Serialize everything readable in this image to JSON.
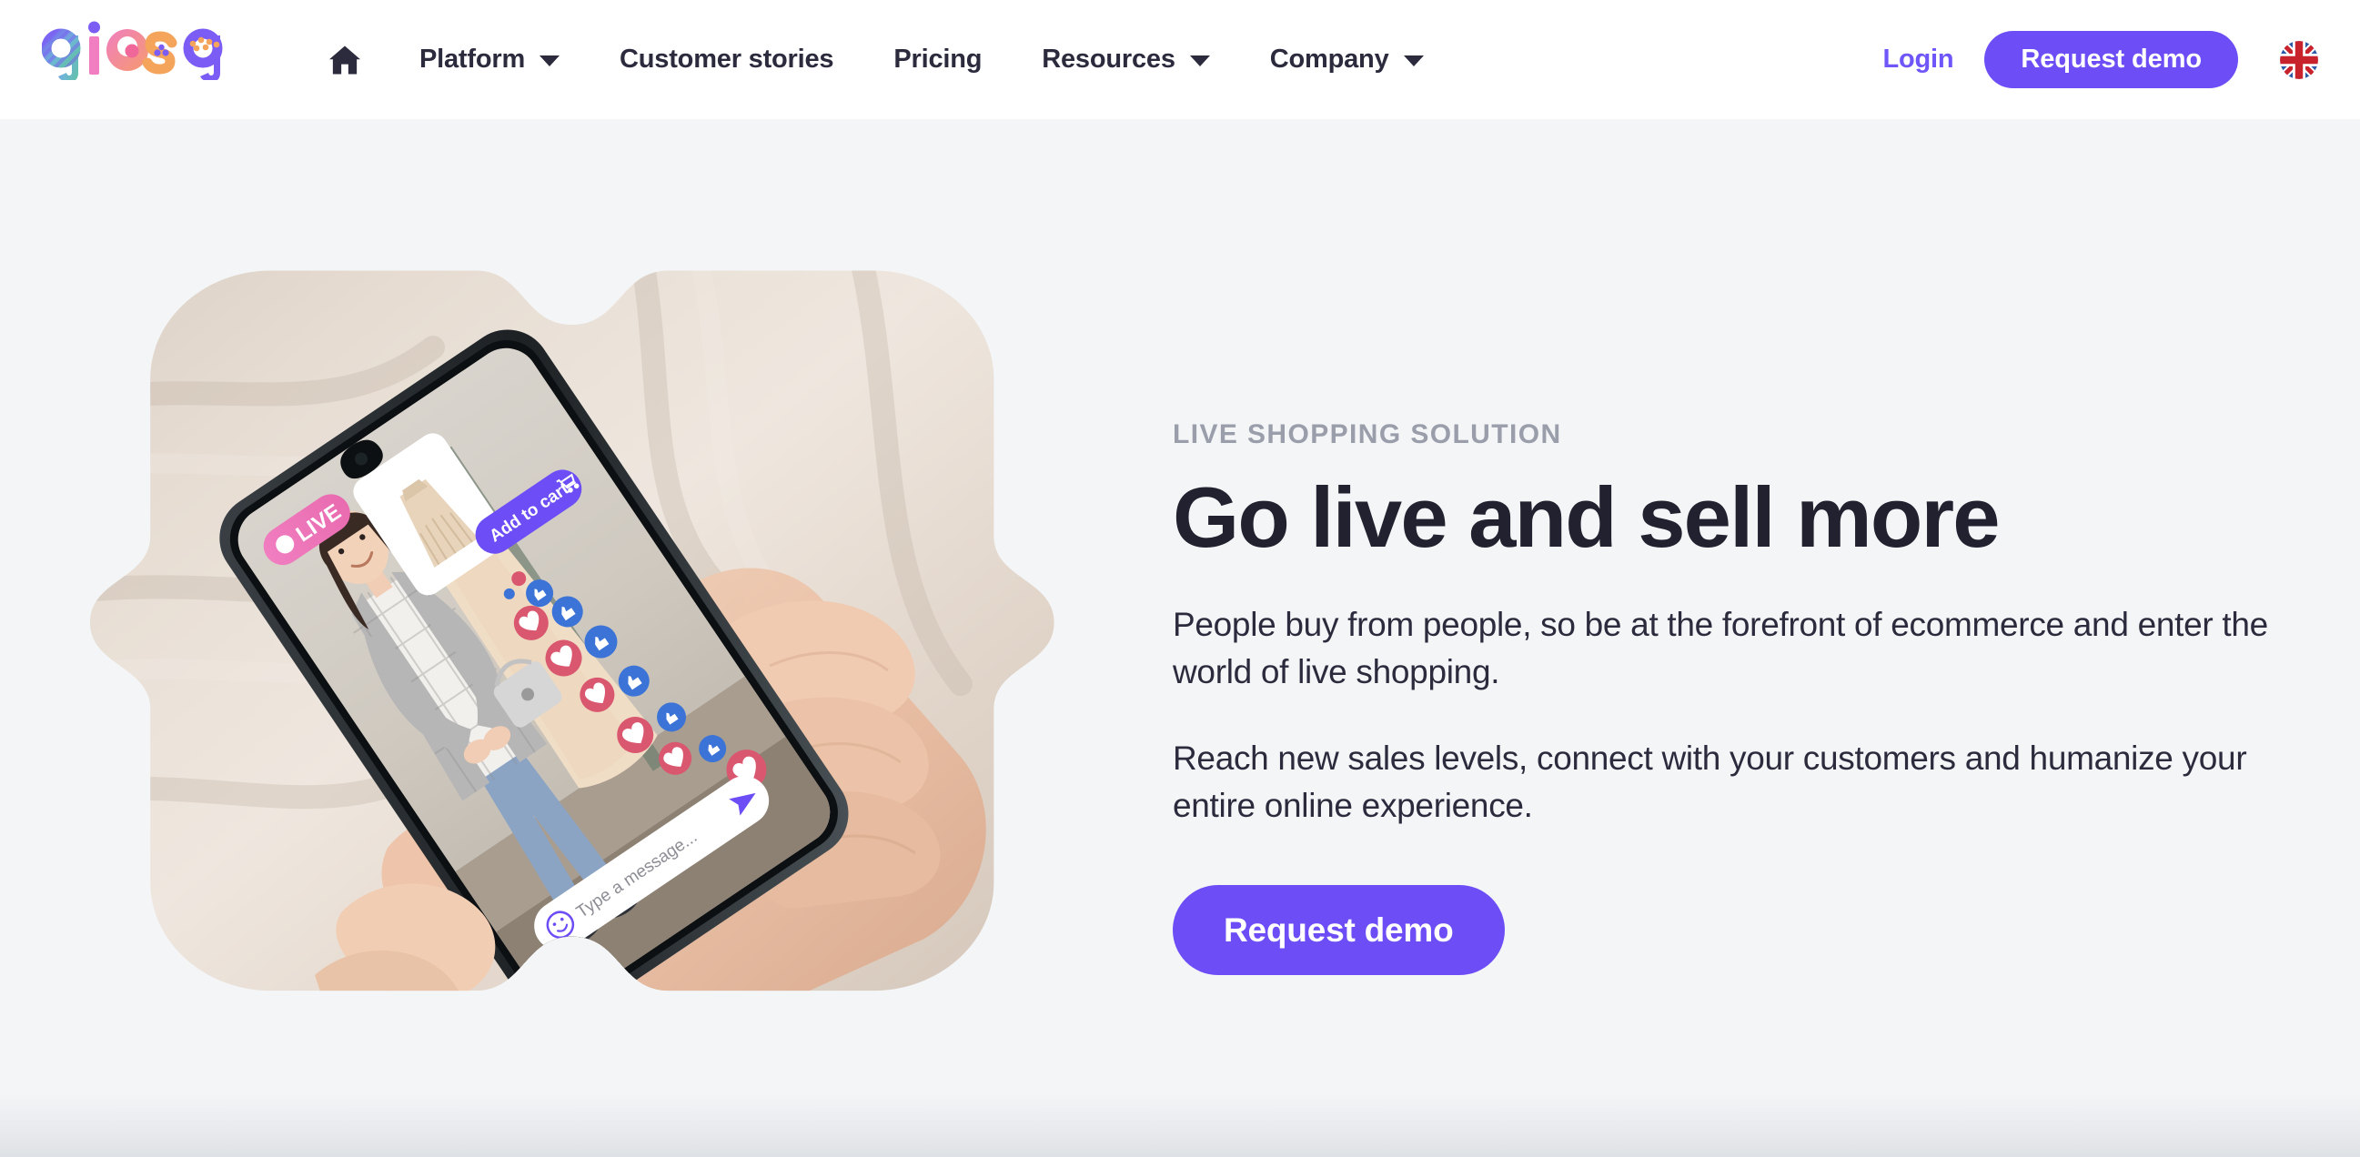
{
  "brand": {
    "name": "giosg",
    "logo_letters": [
      "g",
      "i",
      "o",
      "s",
      "g"
    ],
    "accent_purple": "#6d4df6",
    "accent_pink": "#f07ec0",
    "accent_green": "#5fc3a0",
    "accent_orange": "#f5a45c",
    "text_dark": "#21212f"
  },
  "header": {
    "home_icon": "home-icon",
    "nav": [
      {
        "label": "Platform",
        "has_dropdown": true
      },
      {
        "label": "Customer stories",
        "has_dropdown": false
      },
      {
        "label": "Pricing",
        "has_dropdown": false
      },
      {
        "label": "Resources",
        "has_dropdown": true
      },
      {
        "label": "Company",
        "has_dropdown": true
      }
    ],
    "login_label": "Login",
    "demo_label": "Request demo",
    "language_flag": "united-kingdom-flag-icon",
    "background": "#ffffff"
  },
  "hero": {
    "eyebrow": "LIVE SHOPPING SOLUTION",
    "title": "Go live and sell more",
    "paragraph_1": "People buy from people, so be at the forefront of ecommerce and enter the world of live shopping.",
    "paragraph_2": "Reach new sales levels, connect with your customers and humanize your entire online experience.",
    "cta_label": "Request demo",
    "background": "#f4f5f7",
    "image": {
      "alt": "Hand holding a smartphone showing a live shopping stream on beige linen fabric",
      "shape": "scalloped-blob-mask",
      "overlays": {
        "live_badge": "LIVE",
        "add_to_cart_label": "Add to cart",
        "message_placeholder": "Type a message...",
        "reaction_icons": [
          "heart-icon",
          "thumbs-up-icon"
        ],
        "send_icon": "send-arrow-icon",
        "emoji_icon": "smiley-icon",
        "cart_icon": "shopping-cart-icon"
      }
    }
  }
}
